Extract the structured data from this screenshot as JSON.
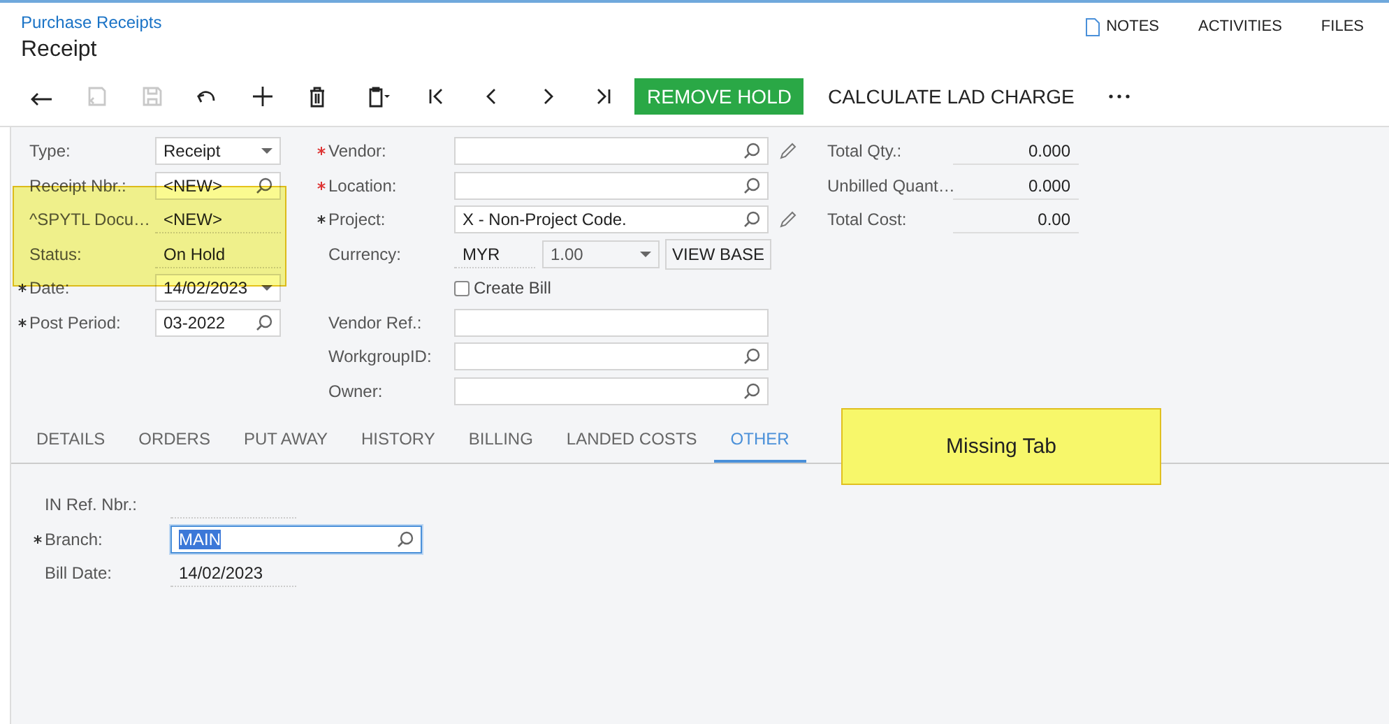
{
  "breadcrumb": "Purchase Receipts",
  "title": "Receipt",
  "top_links": [
    {
      "label": "NOTES",
      "kind": "notes"
    },
    {
      "label": "ACTIVITIES",
      "kind": "plain"
    },
    {
      "label": "FILES",
      "kind": "plain"
    }
  ],
  "toolbar": {
    "icons": [
      {
        "kind": "back",
        "disabled": false
      },
      {
        "kind": "save-close",
        "disabled": true
      },
      {
        "kind": "save",
        "disabled": true
      },
      {
        "kind": "undo",
        "disabled": false
      },
      {
        "kind": "add",
        "disabled": false
      },
      {
        "kind": "delete",
        "disabled": false
      },
      {
        "kind": "clipboard",
        "disabled": false
      },
      {
        "kind": "first",
        "disabled": false
      },
      {
        "kind": "prev",
        "disabled": false
      },
      {
        "kind": "next",
        "disabled": false
      },
      {
        "kind": "last",
        "disabled": false
      }
    ],
    "primary_button": "REMOVE HOLD",
    "button": "CALCULATE LAD CHARGE"
  },
  "form": {
    "column_1": [
      {
        "label": "Type:",
        "kind": "select",
        "value": "Receipt",
        "required": false
      },
      {
        "label": "Receipt Nbr.:",
        "kind": "lookup",
        "value": "<NEW>",
        "required": false
      },
      {
        "label": "^SPYTL Docu…",
        "kind": "readonly",
        "value": "<NEW>",
        "required": false
      },
      {
        "label": "Status:",
        "kind": "readonly",
        "value": "On Hold",
        "required": false
      },
      {
        "label": "Date:",
        "kind": "select",
        "value": "14/02/2023",
        "required": true,
        "missing": false
      },
      {
        "label": "Post Period:",
        "kind": "lookup",
        "value": "03-2022",
        "required": true,
        "missing": false
      }
    ],
    "column_2": [
      {
        "label": "Vendor:",
        "kind": "lookup-edit",
        "required": true,
        "missing": true
      },
      {
        "label": "Location:",
        "kind": "lookup",
        "required": true,
        "missing": true
      },
      {
        "label": "Project:",
        "kind": "lookup-edit",
        "value": "X - Non-Project Code.",
        "required": true,
        "missing": false
      },
      {
        "label": "Currency:",
        "kind": "currency",
        "value": "MYR",
        "rate": "1.00",
        "button": "VIEW BASE",
        "required": false
      },
      {
        "kind": "checkbox",
        "label": "Create Bill",
        "checked": false
      },
      {
        "label": "Vendor Ref.:",
        "kind": "text",
        "required": false
      },
      {
        "label": "WorkgroupID:",
        "kind": "lookup",
        "required": false
      },
      {
        "label": "Owner:",
        "kind": "lookup",
        "required": false
      }
    ],
    "summary": [
      {
        "label": "Total Qty.:",
        "value": "0.000"
      },
      {
        "label": "Unbilled Quant…",
        "value": "0.000"
      },
      {
        "label": "Total Cost:",
        "value": "0.00"
      }
    ]
  },
  "tabs": [
    {
      "label": "DETAILS",
      "selected": false
    },
    {
      "label": "ORDERS",
      "selected": false
    },
    {
      "label": "PUT AWAY",
      "selected": false
    },
    {
      "label": "HISTORY",
      "selected": false
    },
    {
      "label": "BILLING",
      "selected": false
    },
    {
      "label": "LANDED COSTS",
      "selected": false
    },
    {
      "label": "OTHER",
      "selected": true
    }
  ],
  "other_tab": [
    {
      "label": "IN Ref. Nbr.:",
      "kind": "readonly",
      "required": false
    },
    {
      "label": "Branch:",
      "kind": "lookup",
      "value": "MAIN",
      "required": true,
      "focused": true
    },
    {
      "label": "Bill Date:",
      "kind": "readonly",
      "value": "14/02/2023",
      "required": false
    }
  ],
  "callout": "Missing Tab"
}
